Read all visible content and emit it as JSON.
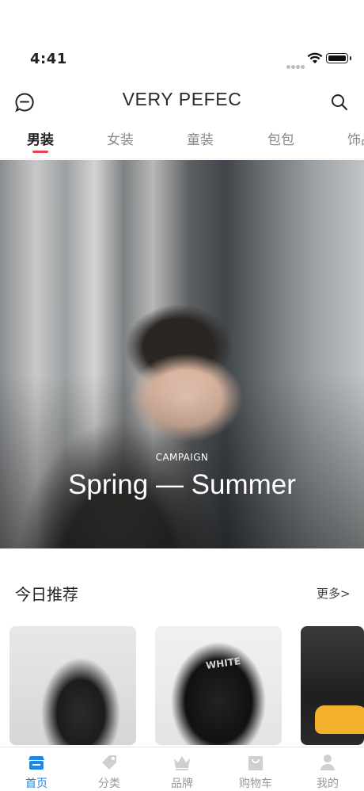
{
  "status_bar": {
    "time": "4:41"
  },
  "header": {
    "title": "VERY PEFEC"
  },
  "tabs": [
    {
      "label": "男装"
    },
    {
      "label": "女装"
    },
    {
      "label": "童装"
    },
    {
      "label": "包包"
    },
    {
      "label": "饰品"
    }
  ],
  "banner": {
    "kicker": "CAMPAIGN",
    "slogan": "Spring — Summer"
  },
  "section": {
    "title": "今日推荐",
    "more": "更多>"
  },
  "recommend_cards": [
    {
      "badge": ""
    },
    {
      "badge": "WHITE"
    },
    {
      "badge": ""
    }
  ],
  "bottom_nav": [
    {
      "label": "首页",
      "icon": "home-store-icon"
    },
    {
      "label": "分类",
      "icon": "tag-icon"
    },
    {
      "label": "品牌",
      "icon": "crown-icon"
    },
    {
      "label": "购物车",
      "icon": "cart-bag-icon"
    },
    {
      "label": "我的",
      "icon": "user-icon"
    }
  ],
  "colors": {
    "accent": "#e8414a",
    "nav_active": "#1e88e5",
    "nav_inactive": "#999999"
  }
}
